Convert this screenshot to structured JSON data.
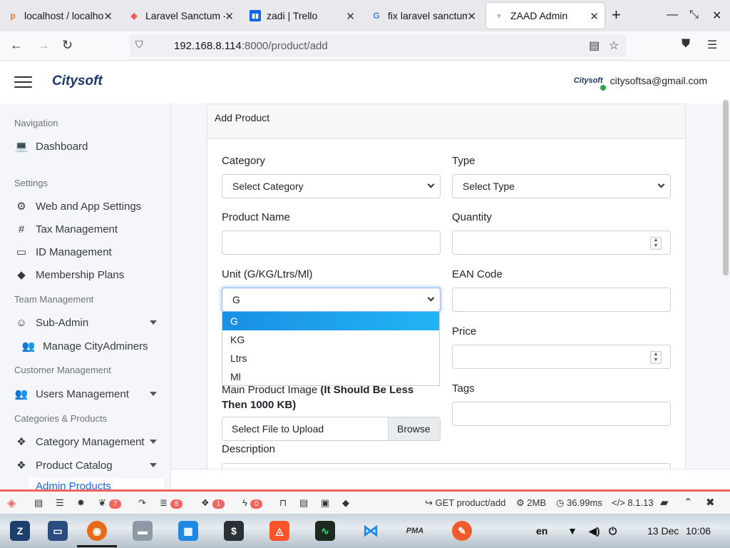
{
  "browser": {
    "tabs": [
      {
        "label": "localhost / localhost",
        "icon": "phpmyadmin-icon"
      },
      {
        "label": "Laravel Sanctum -",
        "icon": "laravel-icon"
      },
      {
        "label": "zadi | Trello",
        "icon": "trello-icon"
      },
      {
        "label": "fix laravel sanctum",
        "icon": "google-icon"
      },
      {
        "label": "ZAAD Admin",
        "icon": "zaad-icon"
      }
    ],
    "url_host": "192.168.8.114",
    "url_path": ":8000/product/add"
  },
  "header": {
    "logo": "Citysoft",
    "user_logo": "Citysoft",
    "email": "citysoftsa@gmail.com"
  },
  "sidebar": {
    "sections": [
      "Navigation",
      "Settings",
      "Team Management",
      "Customer Management",
      "Categories & Products"
    ],
    "items": [
      {
        "label": "Dashboard",
        "icon": "laptop-icon"
      },
      {
        "label": "Web and App Settings",
        "icon": "gear-icon"
      },
      {
        "label": "Tax Management",
        "icon": "hash-icon"
      },
      {
        "label": "ID Management",
        "icon": "id-card-icon"
      },
      {
        "label": "Membership Plans",
        "icon": "tag-icon"
      },
      {
        "label": "Sub-Admin",
        "icon": "user-icon"
      },
      {
        "label": "Manage CityAdminers",
        "icon": "users-icon"
      },
      {
        "label": "Users Management",
        "icon": "users-icon"
      },
      {
        "label": "Category Management",
        "icon": "cubes-icon"
      },
      {
        "label": "Product Catalog",
        "icon": "cubes-icon"
      },
      {
        "label": "Admin Products",
        "icon": ""
      }
    ]
  },
  "form": {
    "title": "Add Product",
    "category_label": "Category",
    "category_value": "Select Category",
    "type_label": "Type",
    "type_value": "Select Type",
    "name_label": "Product Name",
    "quantity_label": "Quantity",
    "unit_label": "Unit (G/KG/Ltrs/Ml)",
    "unit_value": "G",
    "unit_options": [
      "G",
      "KG",
      "Ltrs",
      "Ml"
    ],
    "ean_label": "EAN Code",
    "price_label": "Price",
    "image_label": "Main Product Image",
    "image_note": "(It Should Be Less Then 1000 KB)",
    "file_placeholder": "Select File to Upload",
    "browse_label": "Browse",
    "tags_label": "Tags",
    "description_label": "Description"
  },
  "debugbar": {
    "badges": [
      "7",
      "8",
      "1",
      "0"
    ],
    "route": "GET product/add",
    "memory": "2MB",
    "time": "36.99ms",
    "php": "8.1.13"
  },
  "taskbar": {
    "lang": "en",
    "date": "13 Dec",
    "time": "10:06"
  }
}
